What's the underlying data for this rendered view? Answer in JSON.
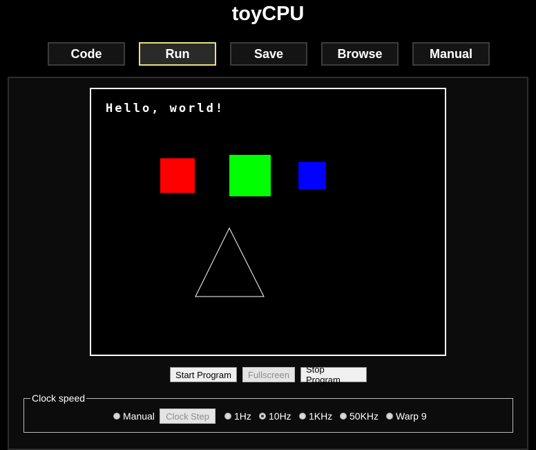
{
  "app": {
    "title": "toyCPU"
  },
  "nav": {
    "code": "Code",
    "run": "Run",
    "save": "Save",
    "browse": "Browse",
    "manual": "Manual",
    "active": "Run",
    "active_color": "#e8e37a"
  },
  "screen": {
    "text": "Hello, world!",
    "shapes": {
      "red_square_color": "#ff0000",
      "green_square_color": "#00ff00",
      "blue_square_color": "#0000ff",
      "triangle_stroke": "#ffffff"
    }
  },
  "controls": {
    "start": "Start Program",
    "fullscreen": "Fullscreen",
    "stop": "Stop Program"
  },
  "clock": {
    "legend": "Clock speed",
    "step_button": "Clock Step",
    "options": [
      "Manual",
      "1Hz",
      "10Hz",
      "1KHz",
      "50KHz",
      "Warp 9"
    ],
    "selected": "10Hz"
  }
}
